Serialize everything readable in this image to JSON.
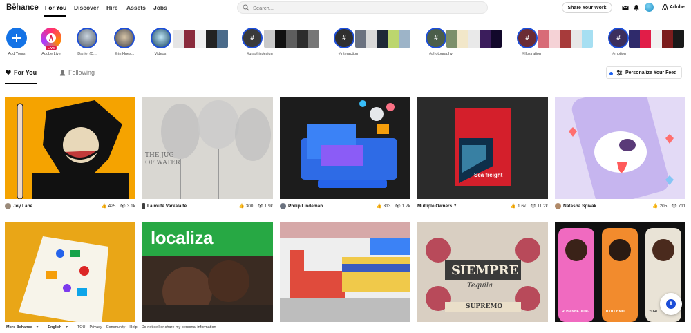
{
  "header": {
    "logo": "Bēhance",
    "nav": [
      "For You",
      "Discover",
      "Hire",
      "Assets",
      "Jobs"
    ],
    "search_placeholder": "Search...",
    "share_label": "Share Your Work",
    "adobe_label": "Adobe"
  },
  "stories": [
    {
      "label": "Add Yours"
    },
    {
      "label": "Adobe Live",
      "badge": "LIVE"
    },
    {
      "label": "Daniel (D..."
    },
    {
      "label": "Erin Hues..."
    },
    {
      "label": "Videos"
    },
    {
      "label": "#graphicdesign"
    },
    {
      "label": "#interaction"
    },
    {
      "label": "#photography"
    },
    {
      "label": "#illustration"
    },
    {
      "label": "#motion"
    }
  ],
  "feed_tabs": {
    "for_you": "For You",
    "following": "Following",
    "personalize": "Personalize Your Feed"
  },
  "projects": [
    {
      "owner": "Joy Lane",
      "likes": "425",
      "views": "3.1k"
    },
    {
      "owner": "Laimutė Varkalaitė",
      "likes": "300",
      "views": "1.9k"
    },
    {
      "owner": "Philip Lindeman",
      "likes": "313",
      "views": "1.7k"
    },
    {
      "owner": "Multiple Owners",
      "likes": "1.6k",
      "views": "11.2k"
    },
    {
      "owner": "Natasha Spivak",
      "likes": "205",
      "views": "711"
    }
  ],
  "art_text": {
    "card2": "THE JUG OF WATER",
    "card4": "Sea freight",
    "card7": "localiza",
    "card9_title": "SIEMPRE",
    "card9_sub": "Tequila",
    "card9_foot": "SUPREMO",
    "card10_names": [
      "ROSANNE JUNG",
      "TOTO Y MOI",
      "YURI..."
    ]
  },
  "footer": {
    "more": "More Behance",
    "lang": "English",
    "links": [
      "TOU",
      "Privacy",
      "Community",
      "Help",
      "Do not sell or share my personal information"
    ]
  },
  "colors": {
    "accent": "#1d4ed8",
    "live": "#e11d48"
  }
}
